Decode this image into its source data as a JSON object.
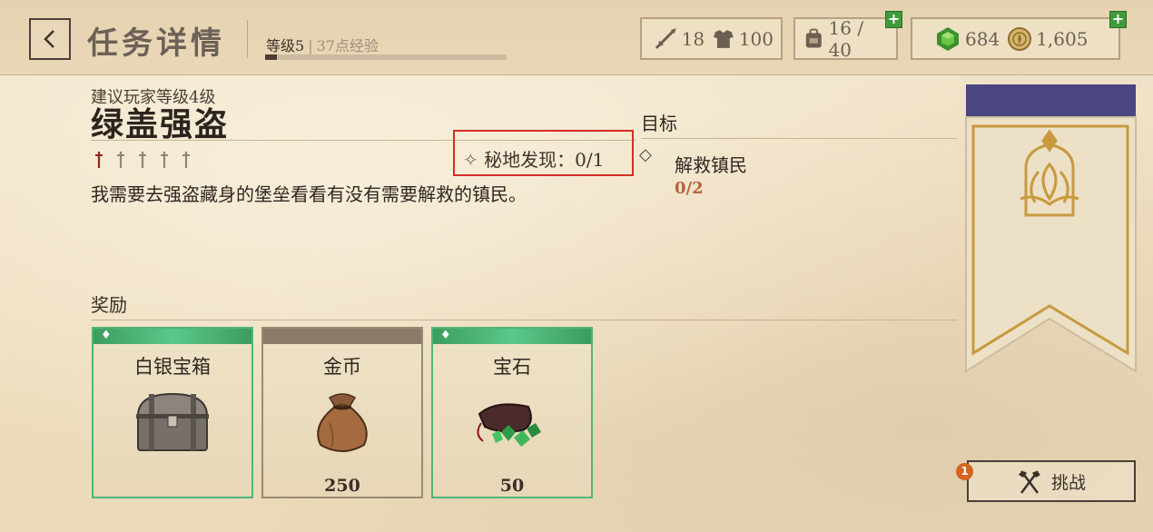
{
  "header": {
    "title": "任务详情",
    "level_label": "等级5",
    "xp_label": "37点经验",
    "xp_progress": 0.05
  },
  "stats": {
    "attack": "18",
    "defense": "100",
    "inventory": "16 / 40",
    "gems": "684",
    "gold": "1,605"
  },
  "quest": {
    "recommended_level": "建议玩家等级4级",
    "name": "绿盖强盗",
    "difficulty": 1,
    "difficulty_max": 5,
    "discovery": "秘地发现：0/1",
    "description": "我需要去强盗藏身的堡垒看看有没有需要解救的镇民。"
  },
  "objectives": {
    "title": "目标",
    "items": [
      {
        "name": "解救镇民",
        "progress": "0/2"
      }
    ]
  },
  "rewards": {
    "title": "奖励",
    "items": [
      {
        "name": "白银宝箱",
        "qty": "",
        "icon": "silver-chest-icon"
      },
      {
        "name": "金币",
        "qty": "250",
        "icon": "coin-bag-icon"
      },
      {
        "name": "宝石",
        "qty": "50",
        "icon": "gem-pouch-icon"
      }
    ]
  },
  "action": {
    "challenge_label": "挑战",
    "badge_count": "1"
  },
  "colors": {
    "accent_orange": "#b5643b",
    "rarity_green": "#4fb57a",
    "banner_purple": "#4a4680",
    "highlight_red": "#d62d28"
  }
}
